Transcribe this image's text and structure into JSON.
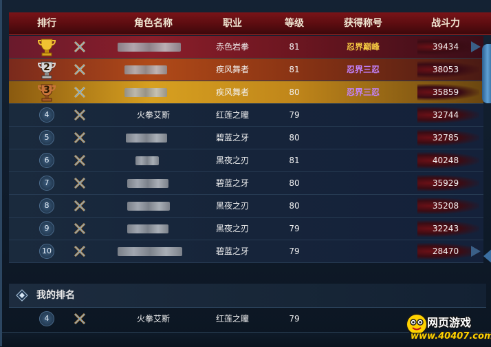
{
  "header": {
    "rank": "排行",
    "name": "角色名称",
    "class": "职业",
    "level": "等级",
    "title": "获得称号",
    "power": "战斗力"
  },
  "rows": [
    {
      "rank": "1",
      "name": "",
      "class": "赤色岩拳",
      "level": "81",
      "title": "忍界巅峰",
      "title_color": "gold",
      "power": "39434"
    },
    {
      "rank": "2",
      "name": "",
      "class": "疾风舞者",
      "level": "81",
      "title": "忍界三忍",
      "title_color": "purple",
      "power": "38053"
    },
    {
      "rank": "3",
      "name": "",
      "class": "疾风舞者",
      "level": "80",
      "title": "忍界三忍",
      "title_color": "purple",
      "power": "35859"
    },
    {
      "rank": "4",
      "name": "火拳艾斯",
      "class": "红莲之瞳",
      "level": "79",
      "title": "",
      "power": "32744"
    },
    {
      "rank": "5",
      "name": "",
      "class": "碧蓝之牙",
      "level": "80",
      "title": "",
      "power": "32785"
    },
    {
      "rank": "6",
      "name": "",
      "class": "黑夜之刃",
      "level": "81",
      "title": "",
      "power": "40248"
    },
    {
      "rank": "7",
      "name": "",
      "class": "碧蓝之牙",
      "level": "80",
      "title": "",
      "power": "35929"
    },
    {
      "rank": "8",
      "name": "",
      "class": "黑夜之刃",
      "level": "80",
      "title": "",
      "power": "35208"
    },
    {
      "rank": "9",
      "name": "",
      "class": "黑夜之刃",
      "level": "79",
      "title": "",
      "power": "32243"
    },
    {
      "rank": "10",
      "name": "",
      "class": "碧蓝之牙",
      "level": "79",
      "title": "",
      "power": "28470"
    }
  ],
  "my_rank": {
    "section_title": "我的排名",
    "rank": "4",
    "name": "火拳艾斯",
    "class": "红莲之瞳",
    "level": "79"
  },
  "watermark": {
    "title": "网页游戏",
    "url": "www.40407.com"
  },
  "colors": {
    "header_red": "#7a1418",
    "title_gold": "#f5c842",
    "title_purple": "#c483ff"
  }
}
